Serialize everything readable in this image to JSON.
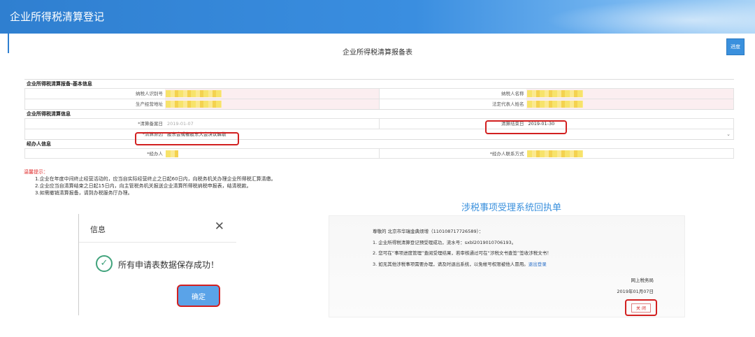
{
  "header": {
    "title": "企业所得税清算登记"
  },
  "form": {
    "title": "企业所得税清算报备表",
    "progress_label": "进度",
    "section_basic": "企业所得税清算报备-基本信息",
    "taxpayer_id_label": "纳税人识别号",
    "taxpayer_name_label": "纳税人名称",
    "address_label": "生产经营地址",
    "legal_rep_label": "法定代表人姓名",
    "section_liquidation": "企业所得税清算信息",
    "start_date_label": "*清算备案日",
    "start_date_value": "2019-01-07",
    "end_date_label": "清算结束日",
    "end_date_value": "2019-01-30",
    "reason_label": "*清算原因",
    "reason_value": "股东会或者股东大会决议解散",
    "section_handler": "经办人信息",
    "handler_label": "*经办人",
    "handler_contact_label": "*经办人联系方式"
  },
  "tips": {
    "head": "温馨提示：",
    "lines": [
      "1.企业在年度中间终止经营活动的，应当自实际经营终止之日起60日内，向税务机关办理企业所得税汇算清缴。",
      "2.企业应当自清算结束之日起15日内，向主管税务机关报送企业清算所得税纳税申报表，结清税款。",
      "3.如需撤销清算报备，请到办税服务厅办理。"
    ]
  },
  "dialog": {
    "title": "信息",
    "close_glyph": "✕",
    "check_glyph": "✓",
    "message": "所有申请表数据保存成功！",
    "confirm_label": "确定"
  },
  "receipt": {
    "title": "涉税事项受理系统回执单",
    "greeting": "尊敬的 北京市华瑞金典烦增（110108717726589）：",
    "line1": "1. 企业所得税清算登记预受理成功，流水号：sxbl2019010706193。",
    "line2": "2. 您可在“事项进度管理”查阅受理结果，若审核通过可在“涉税文书查签”签收涉税文书！",
    "line3": "3. 如无其他涉税事项需要办理，请及时退出系统，以免帐号权限被他人冒用。",
    "line3_link": "退出登录",
    "org": "网上税务局",
    "date": "2019年01月07日",
    "close_label": "关 闭"
  }
}
